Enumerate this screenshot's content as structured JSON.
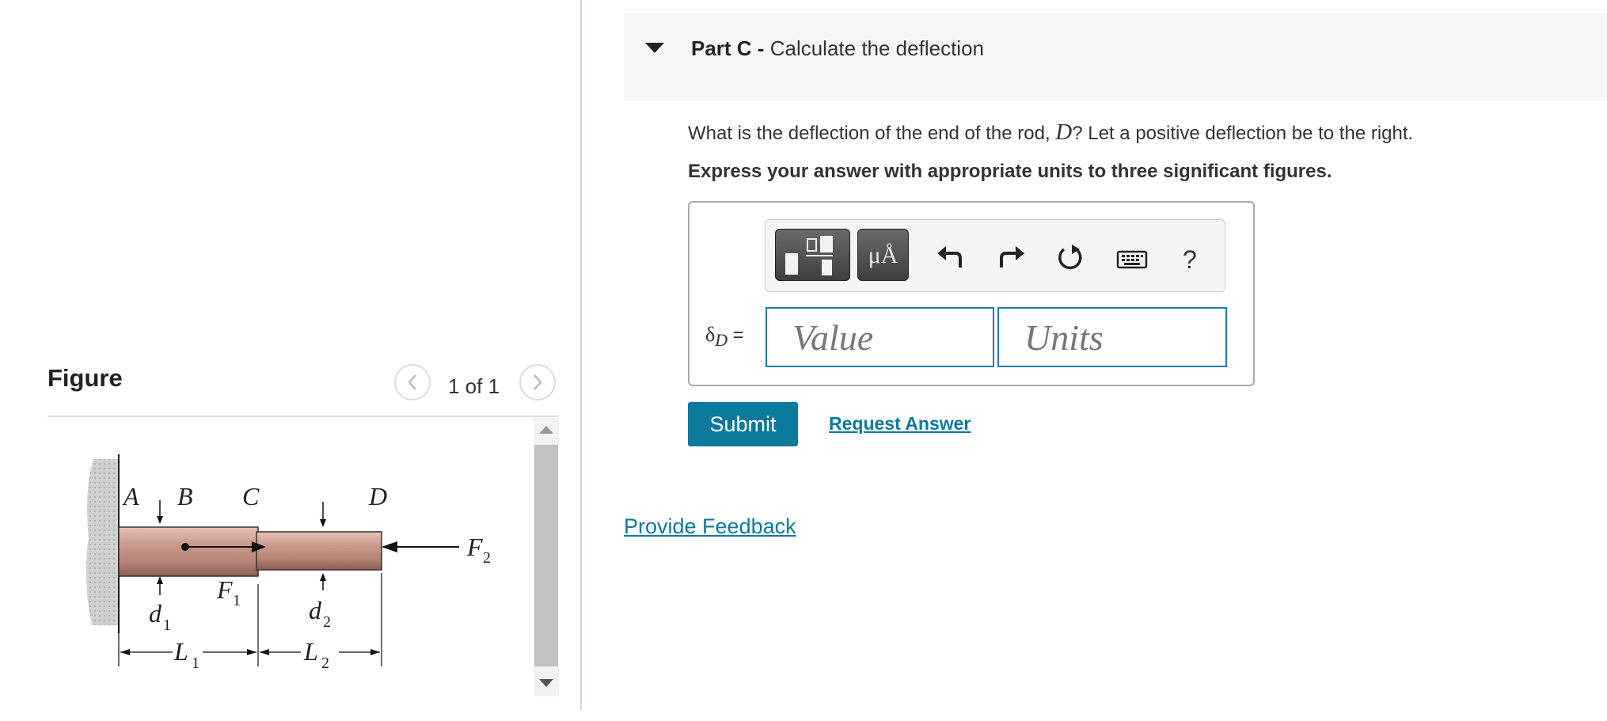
{
  "figure_panel": {
    "title": "Figure",
    "page_indicator": "1 of 1",
    "labels": {
      "A": "A",
      "B": "B",
      "C": "C",
      "D": "D",
      "F1": "F",
      "F1_sub": "1",
      "F2": "F",
      "F2_sub": "2",
      "d1": "d",
      "d1_sub": "1",
      "d2": "d",
      "d2_sub": "2",
      "L1": "L",
      "L1_sub": "1",
      "L2": "L",
      "L2_sub": "2"
    }
  },
  "part": {
    "label": "Part C -",
    "title": "Calculate the deflection"
  },
  "question": {
    "prefix": "What is the deflection of the end of the rod, ",
    "variable": "D",
    "suffix": "? Let a positive deflection be to the right."
  },
  "instruction": "Express your answer with appropriate units to three significant figures.",
  "toolbar": {
    "units_label": "μÅ",
    "help_label": "?",
    "icons": [
      "templates-icon",
      "units-icon",
      "undo-icon",
      "redo-icon",
      "reset-icon",
      "keyboard-icon",
      "help-icon"
    ]
  },
  "answer": {
    "symbol": "δ",
    "symbol_sub": "D",
    "equals": "=",
    "value_placeholder": "Value",
    "units_placeholder": "Units"
  },
  "actions": {
    "submit": "Submit",
    "request_answer": "Request Answer"
  },
  "feedback": "Provide Feedback",
  "colors": {
    "accent": "#0b7a9c",
    "input_border": "#1d7fa8",
    "header_bg": "#f7f7f7"
  }
}
